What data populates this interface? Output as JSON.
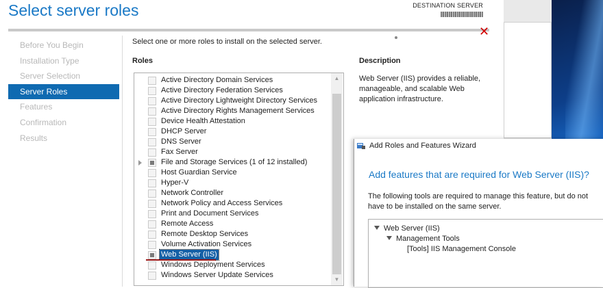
{
  "wizard": {
    "title": "Select server roles",
    "destination_label": "DESTINATION SERVER",
    "close_glyph": "✕"
  },
  "nav": {
    "items": [
      {
        "label": "Before You Begin",
        "active": false
      },
      {
        "label": "Installation Type",
        "active": false
      },
      {
        "label": "Server Selection",
        "active": false
      },
      {
        "label": "Server Roles",
        "active": true
      },
      {
        "label": "Features",
        "active": false
      },
      {
        "label": "Confirmation",
        "active": false
      },
      {
        "label": "Results",
        "active": false
      }
    ]
  },
  "main": {
    "instruction": "Select one or more roles to install on the selected server.",
    "roles_header": "Roles",
    "description_header": "Description",
    "description_text": "Web Server (IIS) provides a reliable, manageable, and scalable Web application infrastructure."
  },
  "roles": [
    {
      "label": "Active Directory Domain Services",
      "state": "unchecked",
      "expandable": false
    },
    {
      "label": "Active Directory Federation Services",
      "state": "unchecked",
      "expandable": false
    },
    {
      "label": "Active Directory Lightweight Directory Services",
      "state": "unchecked",
      "expandable": false
    },
    {
      "label": "Active Directory Rights Management Services",
      "state": "unchecked",
      "expandable": false
    },
    {
      "label": "Device Health Attestation",
      "state": "unchecked",
      "expandable": false
    },
    {
      "label": "DHCP Server",
      "state": "unchecked",
      "expandable": false
    },
    {
      "label": "DNS Server",
      "state": "unchecked",
      "expandable": false
    },
    {
      "label": "Fax Server",
      "state": "unchecked",
      "expandable": false
    },
    {
      "label": "File and Storage Services (1 of 12 installed)",
      "state": "partial",
      "expandable": true
    },
    {
      "label": "Host Guardian Service",
      "state": "unchecked",
      "expandable": false
    },
    {
      "label": "Hyper-V",
      "state": "unchecked",
      "expandable": false
    },
    {
      "label": "Network Controller",
      "state": "unchecked",
      "expandable": false
    },
    {
      "label": "Network Policy and Access Services",
      "state": "unchecked",
      "expandable": false
    },
    {
      "label": "Print and Document Services",
      "state": "unchecked",
      "expandable": false
    },
    {
      "label": "Remote Access",
      "state": "unchecked",
      "expandable": false
    },
    {
      "label": "Remote Desktop Services",
      "state": "unchecked",
      "expandable": false
    },
    {
      "label": "Volume Activation Services",
      "state": "unchecked",
      "expandable": false
    },
    {
      "label": "Web Server (IIS)",
      "state": "partial",
      "expandable": false,
      "selected": true
    },
    {
      "label": "Windows Deployment Services",
      "state": "unchecked",
      "expandable": false
    },
    {
      "label": "Windows Server Update Services",
      "state": "unchecked",
      "expandable": false
    }
  ],
  "dialog": {
    "title": "Add Roles and Features Wizard",
    "heading": "Add features that are required for Web Server (IIS)?",
    "body": "The following tools are required to manage this feature, but do not have to be installed on the same server.",
    "tree": {
      "root": "Web Server (IIS)",
      "child": "Management Tools",
      "leaf": "[Tools] IIS Management Console"
    }
  },
  "colors": {
    "accent": "#1a79c6",
    "nav_active": "#0f6ab1",
    "close": "#d00000"
  }
}
